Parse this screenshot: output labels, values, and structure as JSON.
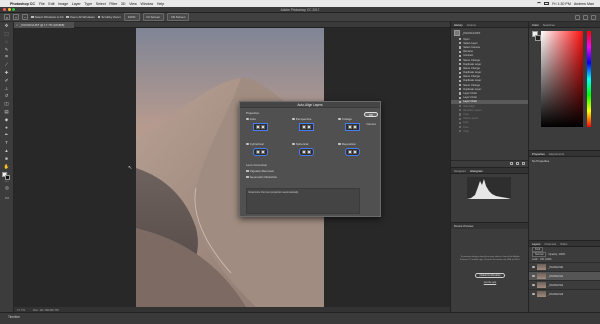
{
  "menubar": {
    "app": "Photoshop CC",
    "items": [
      "File",
      "Edit",
      "Image",
      "Layer",
      "Type",
      "Select",
      "Filter",
      "3D",
      "View",
      "Window",
      "Help"
    ],
    "clock": "Fri 1:30 PM",
    "user": "Andrew Man"
  },
  "titlebar": {
    "title": "Adobe Photoshop CC 2017"
  },
  "optionsbar": {
    "select_label": "Select Windows to Fit",
    "zoom_all_label": "Zoom All Windows",
    "scrubby_label": "Scrubby Zoom",
    "btn_100": "100%",
    "btn_fit": "Fit Screen",
    "btn_fill": "Fill Screen"
  },
  "document": {
    "tab_label": "_PAC0GVHST @ 17.7% (RGB/8)",
    "status": "17.7%",
    "doc_info": "Doc: 111.7M/320.7M"
  },
  "dialog": {
    "title": "Auto-Align Layers",
    "projection_label": "Projection",
    "options": [
      {
        "label": "Auto",
        "selected": true
      },
      {
        "label": "Perspective",
        "selected": false
      },
      {
        "label": "Collage",
        "selected": false
      },
      {
        "label": "Cylindrical",
        "selected": false
      },
      {
        "label": "Spherical",
        "selected": false
      },
      {
        "label": "Reposition",
        "selected": false
      }
    ],
    "lens_label": "Lens Correction",
    "vignette_label": "Vignette Removal",
    "distortion_label": "Geometric Distortion",
    "description": "Determine the best projection automatically.",
    "ok_label": "OK",
    "cancel_label": "Cancel"
  },
  "history": {
    "tabs": [
      "History",
      "Actions"
    ],
    "snapshot": "_PAC0GVHST",
    "items": [
      {
        "label": "Open",
        "state": "normal"
      },
      {
        "label": "Select Layer",
        "state": "normal"
      },
      {
        "label": "Select Canvas",
        "state": "normal"
      },
      {
        "label": "Rename",
        "state": "normal"
      },
      {
        "label": "Contract",
        "state": "normal"
      },
      {
        "label": "Name Change",
        "state": "normal"
      },
      {
        "label": "Duplicate Layer",
        "state": "normal"
      },
      {
        "label": "Name Change",
        "state": "normal"
      },
      {
        "label": "Duplicate Layer",
        "state": "normal"
      },
      {
        "label": "Name Change",
        "state": "normal"
      },
      {
        "label": "Duplicate Layer",
        "state": "normal"
      },
      {
        "label": "Name Change",
        "state": "normal"
      },
      {
        "label": "Duplicate Layer",
        "state": "normal"
      },
      {
        "label": "Layer Order",
        "state": "normal"
      },
      {
        "label": "Layer Order",
        "state": "normal"
      },
      {
        "label": "Layer Order",
        "state": "selected"
      },
      {
        "label": "Auto Align",
        "state": "dim"
      },
      {
        "label": "Deselect Layers",
        "state": "dim"
      },
      {
        "label": "Crop",
        "state": "dim"
      },
      {
        "label": "Close Layers",
        "state": "dim"
      },
      {
        "label": "Free",
        "state": "dim"
      },
      {
        "label": "Free",
        "state": "dim"
      },
      {
        "label": "Crop",
        "state": "dim"
      }
    ]
  },
  "navigator": {
    "tabs": [
      "Navigator",
      "Histogram"
    ]
  },
  "media": {
    "title": "Device Preview",
    "message": "To preview designs directly on your device, launch the Adobe Preview CC mobile app. Connect the device via USB or Wi-Fi.",
    "button": "Check for Devices",
    "link": "Get the app"
  },
  "color": {
    "tabs": [
      "Color",
      "Swatches"
    ]
  },
  "properties": {
    "tabs": [
      "Properties",
      "Adjustments"
    ],
    "empty": "No Properties"
  },
  "layers": {
    "tabs": [
      "Layers",
      "Channels",
      "Paths"
    ],
    "kind_label": "Kind",
    "mode": "Normal",
    "opacity_label": "Opacity: 100%",
    "lock_label": "Lock:",
    "fill_label": "Fill: 100%",
    "items": [
      {
        "name": "_PAC0GVH0",
        "selected": false
      },
      {
        "name": "_PAC0GVH1",
        "selected": true
      },
      {
        "name": "_PAC0GVH2",
        "selected": false
      },
      {
        "name": "_PAC0GVH3",
        "selected": false
      }
    ]
  },
  "timeline": {
    "label": "Timeline"
  },
  "colors": {
    "accent": "#4a7ef0",
    "panel": "#3c3c3c",
    "canvas_bg": "#282828"
  }
}
